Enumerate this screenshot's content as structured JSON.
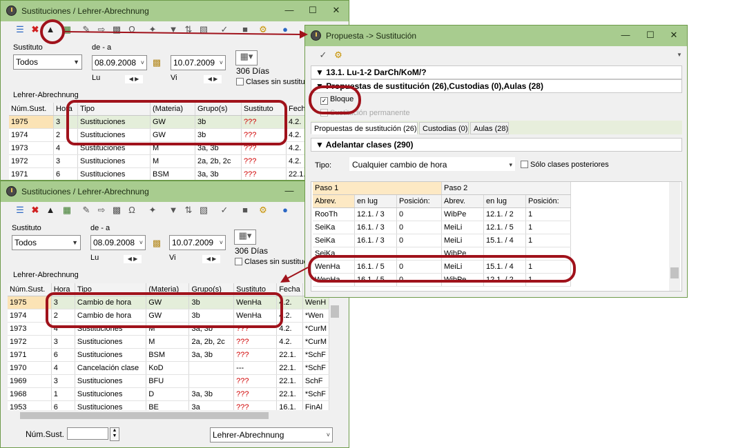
{
  "window1": {
    "title": "Sustituciones / Lehrer-Abrechnung",
    "sustituto_label": "Sustituto",
    "sustituto_value": "Todos",
    "range_label": "de - a",
    "date_from": "08.09.2008",
    "date_to": "10.07.2009",
    "day_from": "Lu",
    "day_to": "Vi",
    "days_count": "306 Días",
    "clases_sin": "Clases sin sustitución",
    "section_label": "Lehrer-Abrechnung",
    "headers": [
      "Núm.Sust.",
      "Hora",
      "Tipo",
      "(Materia)",
      "Grupo(s)",
      "Sustituto",
      "Fech"
    ],
    "rows": [
      [
        "1975",
        "3",
        "Sustituciones",
        "GW",
        "3b",
        "???",
        "4.2."
      ],
      [
        "1974",
        "2",
        "Sustituciones",
        "GW",
        "3b",
        "???",
        "4.2."
      ],
      [
        "1973",
        "4",
        "Sustituciones",
        "M",
        "3a, 3b",
        "???",
        "4.2."
      ],
      [
        "1972",
        "3",
        "Sustituciones",
        "M",
        "2a, 2b, 2c",
        "???",
        "4.2."
      ],
      [
        "1971",
        "6",
        "Sustituciones",
        "BSM",
        "3a, 3b",
        "???",
        "22.1."
      ]
    ]
  },
  "window2": {
    "title": "Sustituciones / Lehrer-Abrechnung",
    "sustituto_label": "Sustituto",
    "sustituto_value": "Todos",
    "range_label": "de - a",
    "date_from": "08.09.2008",
    "date_to": "10.07.2009",
    "day_from": "Lu",
    "day_to": "Vi",
    "days_count": "306 Días",
    "clases_sin": "Clases sin sustitución",
    "section_label": "Lehrer-Abrechnung",
    "headers": [
      "Núm.Sust.",
      "Hora",
      "Tipo",
      "(Materia)",
      "Grupo(s)",
      "Sustituto",
      "Fecha",
      ""
    ],
    "rows": [
      [
        "1975",
        "3",
        "Cambio de hora",
        "GW",
        "3b",
        "WenHa",
        "4.2.",
        "WenH"
      ],
      [
        "1974",
        "2",
        "Cambio de hora",
        "GW",
        "3b",
        "WenHa",
        "4.2.",
        "*Wen"
      ],
      [
        "1973",
        "4",
        "Sustituciones",
        "M",
        "3a, 3b",
        "???",
        "4.2.",
        "*CurM"
      ],
      [
        "1972",
        "3",
        "Sustituciones",
        "M",
        "2a, 2b, 2c",
        "???",
        "4.2.",
        "*CurM"
      ],
      [
        "1971",
        "6",
        "Sustituciones",
        "BSM",
        "3a, 3b",
        "???",
        "22.1.",
        "*SchF"
      ],
      [
        "1970",
        "4",
        "Cancelación clase",
        "KoD",
        "",
        "---",
        "22.1.",
        "*SchF"
      ],
      [
        "1969",
        "3",
        "Sustituciones",
        "BFU",
        "",
        "???",
        "22.1.",
        "SchF"
      ],
      [
        "1968",
        "1",
        "Sustituciones",
        "D",
        "3a, 3b",
        "???",
        "22.1.",
        "*SchF"
      ],
      [
        "1953",
        "6",
        "Sustituciones",
        "BE",
        "3a",
        "???",
        "16.1.",
        "FinAl"
      ]
    ],
    "num_sust_label": "Núm.Sust.",
    "num_sust_value": "",
    "report_select": "Lehrer-Abrechnung"
  },
  "window3": {
    "title": "Propuesta -> Sustitución",
    "lesson_header": "13.1. Lu-1-2 DarCh/KoM/?",
    "proposals_header": "Propuestas de sustitución (26),Custodias (0),Aulas (28)",
    "bloque_label": "Bloque",
    "permanente_label": "Sustitución permanente",
    "tabs": [
      "Propuestas de sustitución (26)",
      "Custodias (0)",
      "Aulas (28)"
    ],
    "adelantar_header": "Adelantar clases (290)",
    "tipo_label": "Tipo:",
    "tipo_value": "Cualquier cambio de hora",
    "solo_label": "Sólo clases posteriores",
    "paso1_label": "Paso 1",
    "paso2_label": "Paso 2",
    "headers": [
      "Abrev.",
      "en lug",
      "Posición:",
      "Abrev.",
      "en lug",
      "Posición:"
    ],
    "rows": [
      [
        "RooTh",
        "12.1. / 3",
        "0",
        "WibPe",
        "12.1. / 2",
        "1"
      ],
      [
        "SeiKa",
        "16.1. / 3",
        "0",
        "MeiLi",
        "12.1. / 5",
        "1"
      ],
      [
        "SeiKa",
        "16.1. / 3",
        "0",
        "MeiLi",
        "15.1. / 4",
        "1"
      ],
      [
        "SeiKa",
        "",
        "",
        "WibPe",
        "",
        ""
      ],
      [
        "WenHa",
        "16.1. / 5",
        "0",
        "MeiLi",
        "15.1. / 4",
        "1"
      ],
      [
        "WenHa",
        "16.1. / 5",
        "0",
        "WibPe",
        "12.1. / 2",
        "1"
      ]
    ]
  },
  "colors": {
    "titlebar": "#a8cc8f",
    "highlight_ring": "#a0121b",
    "unassigned": "#d00000",
    "selected_row": "#e4eeda",
    "selected_id": "#fbe3b5"
  }
}
